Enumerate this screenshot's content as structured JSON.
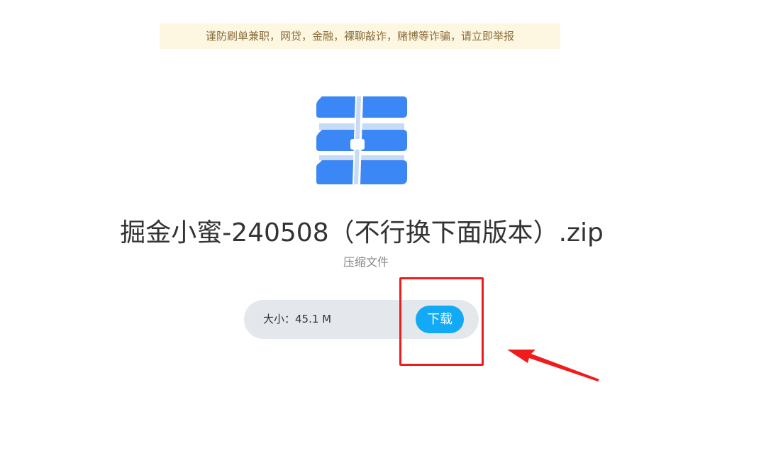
{
  "warning": {
    "text": "谨防刷单兼职，网贷，金融，裸聊敲诈，赌博等诈骗，请立即举报"
  },
  "file": {
    "icon": "zip-archive-icon",
    "icon_color": "#3b87f5",
    "name": "掘金小蜜-240508（不行换下面版本）.zip",
    "type": "压缩文件",
    "size_label": "大小：",
    "size_value": "45.1 M"
  },
  "actions": {
    "download_label": "下载",
    "download_color": "#12a9f5"
  },
  "annotation": {
    "color": "#ee1c1c",
    "shapes": [
      "red-box",
      "red-arrow"
    ]
  }
}
